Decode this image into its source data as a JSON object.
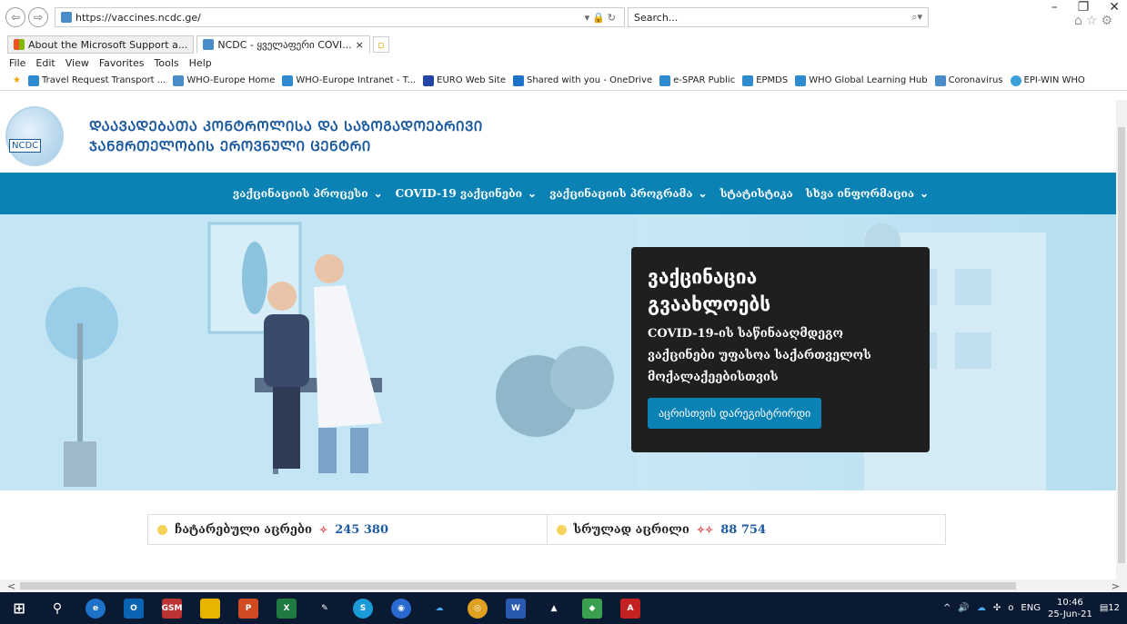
{
  "browser": {
    "url": "https://vaccines.ncdc.ge/",
    "search_placeholder": "Search...",
    "tabs": [
      {
        "label": "About the Microsoft Support a..."
      },
      {
        "label": "NCDC - ყველაფერი COVI...",
        "close": "×"
      }
    ],
    "menu": [
      "File",
      "Edit",
      "View",
      "Favorites",
      "Tools",
      "Help"
    ],
    "favorites": [
      "Travel Request Transport ...",
      "WHO-Europe Home",
      "WHO-Europe Intranet - T...",
      "EURO Web Site",
      "Shared with you - OneDrive",
      "e-SPAR Public",
      "EPMDS",
      "WHO Global Learning Hub",
      "Coronavirus",
      "EPI-WIN WHO"
    ]
  },
  "site": {
    "logo_text": "NCDC",
    "name_line1": "ᲓᲐᲐᲕᲐᲓᲔᲑᲐᲗᲐ ᲙᲝᲜᲢᲠᲝᲚᲘᲡᲐ ᲓᲐ ᲡᲐᲖᲝᲒᲐᲓᲝᲔᲑᲠᲘᲕᲘ",
    "name_line2": "ᲯᲐᲜᲛᲠᲗᲔᲚᲝᲑᲘᲡ ᲔᲠᲝᲕᲜᲣᲚᲘ ᲪᲔᲜᲢᲠᲘ",
    "nav": [
      {
        "label": "ვაქცინაციის პროცესი",
        "dropdown": true
      },
      {
        "label": "COVID-19 ვაქცინები",
        "dropdown": true
      },
      {
        "label": "ვაქცინაციის პროგრამა",
        "dropdown": true
      },
      {
        "label": "სტატისტიკა",
        "dropdown": false
      },
      {
        "label": "სხვა ინფორმაცია",
        "dropdown": true
      }
    ]
  },
  "hero": {
    "title_line1": "ვაქცინაცია",
    "title_line2": "გვაახლოებს",
    "text": "COVID-19-ის საწინააღმდეგო ვაქცინები უფასოა საქართველოს მოქალაქეებისთვის",
    "button": "აცრისთვის დარეგისტრირდი"
  },
  "stats": [
    {
      "label": "ჩატარებული აცრები",
      "value": "245 380"
    },
    {
      "label": "სრულად აცრილი",
      "value": "88 754"
    }
  ],
  "taskbar": {
    "lang": "ENG",
    "time": "10:46",
    "date": "25-Jun-21",
    "notifications": "12"
  },
  "colors": {
    "nav_bg": "#0a82b4",
    "brand": "#1c5aa0",
    "card_bg": "#1f1f1f"
  }
}
